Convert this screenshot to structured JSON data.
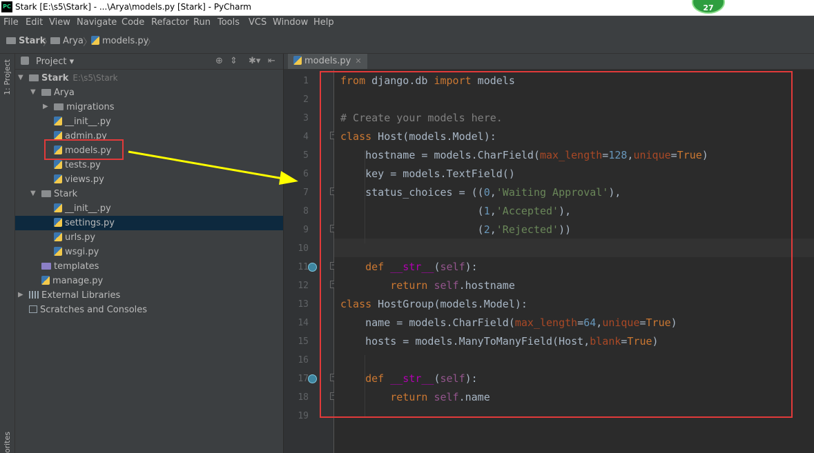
{
  "window": {
    "app_icon_text": "PC",
    "title": "Stark [E:\\s5\\Stark] - ...\\Arya\\models.py [Stark] - PyCharm",
    "notification_count": "27"
  },
  "menu": [
    "File",
    "Edit",
    "View",
    "Navigate",
    "Code",
    "Refactor",
    "Run",
    "Tools",
    "VCS",
    "Window",
    "Help"
  ],
  "breadcrumb": [
    "Stark",
    "Arya",
    "models.py"
  ],
  "tool_windows": {
    "project_tab": "1: Project",
    "favorites_tab": "orites"
  },
  "project_panel": {
    "title": "Project",
    "tree": [
      {
        "label": "Stark",
        "path": "E:\\s5\\Stark",
        "type": "folder",
        "bold": true
      },
      {
        "label": "Arya",
        "type": "folder"
      },
      {
        "label": "migrations",
        "type": "folder"
      },
      {
        "label": "__init__.py",
        "type": "py"
      },
      {
        "label": "admin.py",
        "type": "py"
      },
      {
        "label": "models.py",
        "type": "py"
      },
      {
        "label": "tests.py",
        "type": "py"
      },
      {
        "label": "views.py",
        "type": "py"
      },
      {
        "label": "Stark",
        "type": "folder"
      },
      {
        "label": "__init__.py",
        "type": "py"
      },
      {
        "label": "settings.py",
        "type": "py",
        "selected": true
      },
      {
        "label": "urls.py",
        "type": "py"
      },
      {
        "label": "wsgi.py",
        "type": "py"
      },
      {
        "label": "templates",
        "type": "folder"
      },
      {
        "label": "manage.py",
        "type": "py"
      },
      {
        "label": "External Libraries",
        "type": "lib"
      },
      {
        "label": "Scratches and Consoles",
        "type": "scratch"
      }
    ]
  },
  "editor": {
    "tab_label": "models.py",
    "line_numbers": [
      "1",
      "2",
      "3",
      "4",
      "5",
      "6",
      "7",
      "8",
      "9",
      "10",
      "11",
      "12",
      "13",
      "14",
      "15",
      "16",
      "17",
      "18",
      "19"
    ],
    "code_lines": [
      "from django.db import models",
      "",
      "# Create your models here.",
      "class Host(models.Model):",
      "    hostname = models.CharField(max_length=128,unique=True)",
      "    key = models.TextField()",
      "    status_choices = ((0,'Waiting Approval'),",
      "                      (1,'Accepted'),",
      "                      (2,'Rejected'))",
      "",
      "    def __str__(self):",
      "        return self.hostname",
      "class HostGroup(models.Model):",
      "    name = models.CharField(max_length=64,unique=True)",
      "    hosts = models.ManyToManyField(Host,blank=True)",
      "",
      "    def __str__(self):",
      "        return self.name",
      ""
    ]
  },
  "colors": {
    "annotation": "#e23a3a",
    "arrow": "#ffff00",
    "keyword": "#cc7832",
    "string": "#6a8759",
    "number": "#6897bb",
    "comment": "#808080",
    "param": "#aa4926"
  }
}
